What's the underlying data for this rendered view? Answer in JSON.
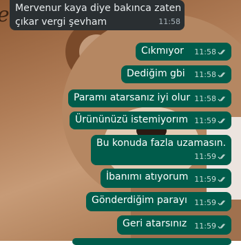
{
  "incoming": {
    "text_line1": "Mervenur kaya diye bakınca zaten",
    "text_line2": "çıkar vergi şevham",
    "time": "11:58"
  },
  "messages": [
    {
      "text": "Cıkmıyor",
      "time": "11:58"
    },
    {
      "text": "Dediğim gbi",
      "time": "11:58"
    },
    {
      "text": "Paramı atarsanız iyi olur",
      "time": "11:58"
    },
    {
      "text": "Ürününüzü istemiyorım",
      "time": "11:59"
    },
    {
      "text": "Bu konuda fazla uzamasın.",
      "time": "11:59"
    },
    {
      "text": "İbanımı atıyorum",
      "time": "11:59"
    },
    {
      "text": "Gönderdiğim parayı",
      "time": "11:59"
    },
    {
      "text": "Geri atarsınız",
      "time": "11:59"
    }
  ],
  "colors": {
    "outgoing_bubble": "#005c4b",
    "incoming_bubble": "#2a2f32",
    "read_tick": "#c9dcd8"
  },
  "icons": {
    "read_receipt": "double-check-icon"
  }
}
